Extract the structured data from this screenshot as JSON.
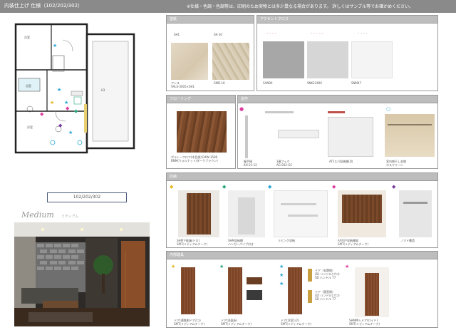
{
  "header": {
    "title": "内装仕上げ 仕様（102/202/302）",
    "note": "※仕様・色調・色調等は、印刷のため実物とは多少異なる場合があります。 詳しくはサンプル等でお確かめください。"
  },
  "plan": {
    "unit_label": "102/202/302"
  },
  "photo": {
    "style_name": "Medium",
    "style_sub": "ミディアム"
  },
  "sections": {
    "wallpaper": {
      "title": "壁紙",
      "items": [
        {
          "code": "SH1",
          "caption": "アレス\nVALS-3005×SH1"
        },
        {
          "code": "SH 30",
          "caption": "SMD-10"
        }
      ]
    },
    "accent_cloth": {
      "title": "アクセントクロス",
      "items": [
        {
          "code": "",
          "caption": "SAN90"
        },
        {
          "code": "",
          "caption": "SNK23496"
        },
        {
          "code": "",
          "caption": "SNM47"
        }
      ]
    },
    "flooring": {
      "title": "フローリング",
      "items": [
        {
          "caption": "ボラトーフロア(木目調) D4W-3586\nBNM(ウォルナット/ダークブラウン)"
        }
      ]
    },
    "fittings": {
      "title": "造作",
      "items": [
        {
          "caption": "握手棒\nKH-21-12"
        },
        {
          "caption": "3連フック\nAG-932-GC"
        },
        {
          "caption": "ATFスパ収納棚(D)"
        },
        {
          "caption": "室内物干し金物\nホスクリーン"
        }
      ]
    },
    "storage": {
      "title": "収納",
      "items": [
        {
          "caption": "SHM下駄箱(ドロ)\nSMT(ミディアムチーク)"
        },
        {
          "caption": "SHM収納棚\nハンガーパイプ付き"
        },
        {
          "caption": "リビング収納"
        },
        {
          "caption": "AF吊戸収納棚扉\nSMT(ミディアムチーク)"
        },
        {
          "caption": "ノマド書斎"
        }
      ]
    },
    "interior_doors": {
      "title": "内部建具",
      "items": [
        {
          "caption": "ドア(通路側ドア2コ)\nSMT(ミディアムチーク)"
        },
        {
          "caption": "ドア(洗面所)\nSMT(ミディアムチーク)"
        },
        {
          "caption": "ドア(洋室1/2)\nSMT(ミディアムチーク)"
        },
        {
          "caption": "SHM押入ドア(ロイド)\nSMT(ミディアムチーク)"
        }
      ],
      "notes": [
        "ドア（玄関側）\n(D) ハンドル(ブロ)\nSD ハンドル 77",
        "ドア（寝室側）\n(D) ハンドル(ブロ)\nSD ハンドル 77"
      ]
    }
  },
  "colors": {
    "header_bg": "#8a8a8a",
    "panel_hdr": "#bdbdbd",
    "wood": "#7a4a2a"
  }
}
